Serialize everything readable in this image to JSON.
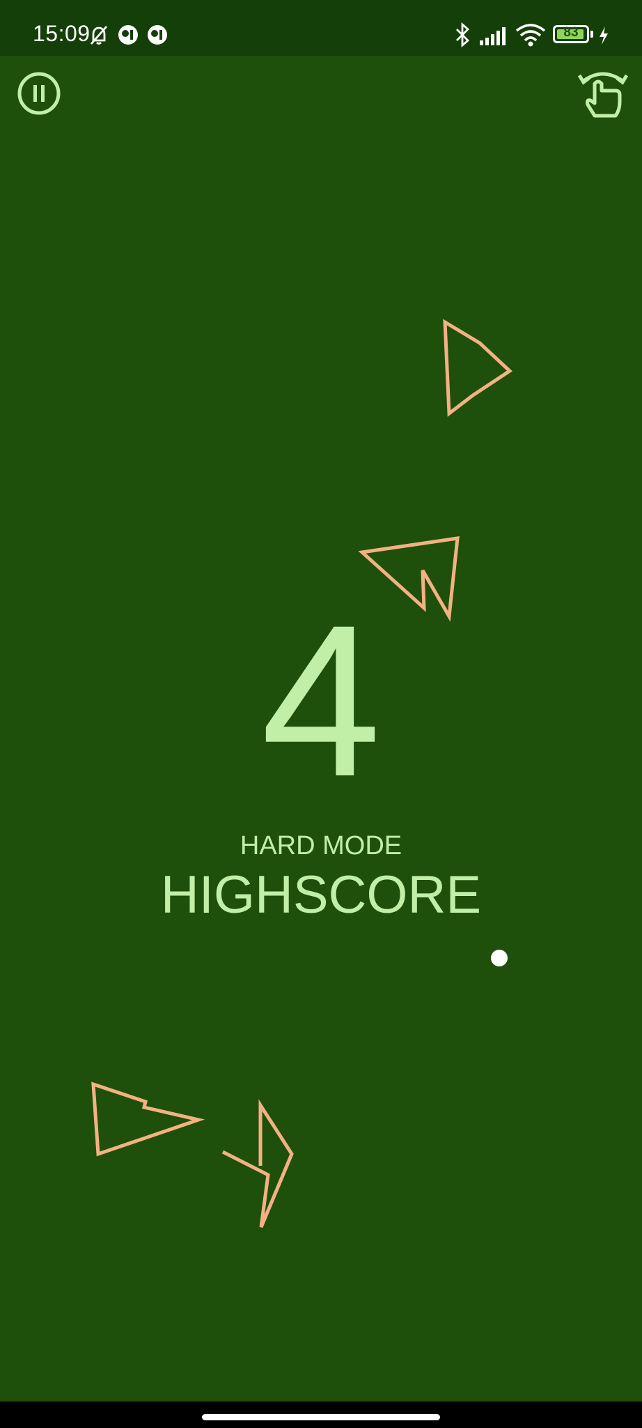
{
  "status_bar": {
    "time": "15:09",
    "battery_level": "83",
    "icons": [
      "muted-bell-icon",
      "app-notification-icon",
      "app-notification-icon",
      "bluetooth-icon",
      "signal-icon",
      "wifi-icon",
      "battery-icon",
      "charging-icon"
    ]
  },
  "game": {
    "score": "4",
    "mode_label": "HARD MODE",
    "highscore_label": "HIGHSCORE",
    "colors": {
      "background": "#1e500c",
      "text": "#c1efa8",
      "obstacle": "#f4b184",
      "ball": "#ffffff"
    }
  },
  "controls": {
    "pause_icon": "pause-icon",
    "tap_rotate_icon": "tap-rotate-icon"
  }
}
